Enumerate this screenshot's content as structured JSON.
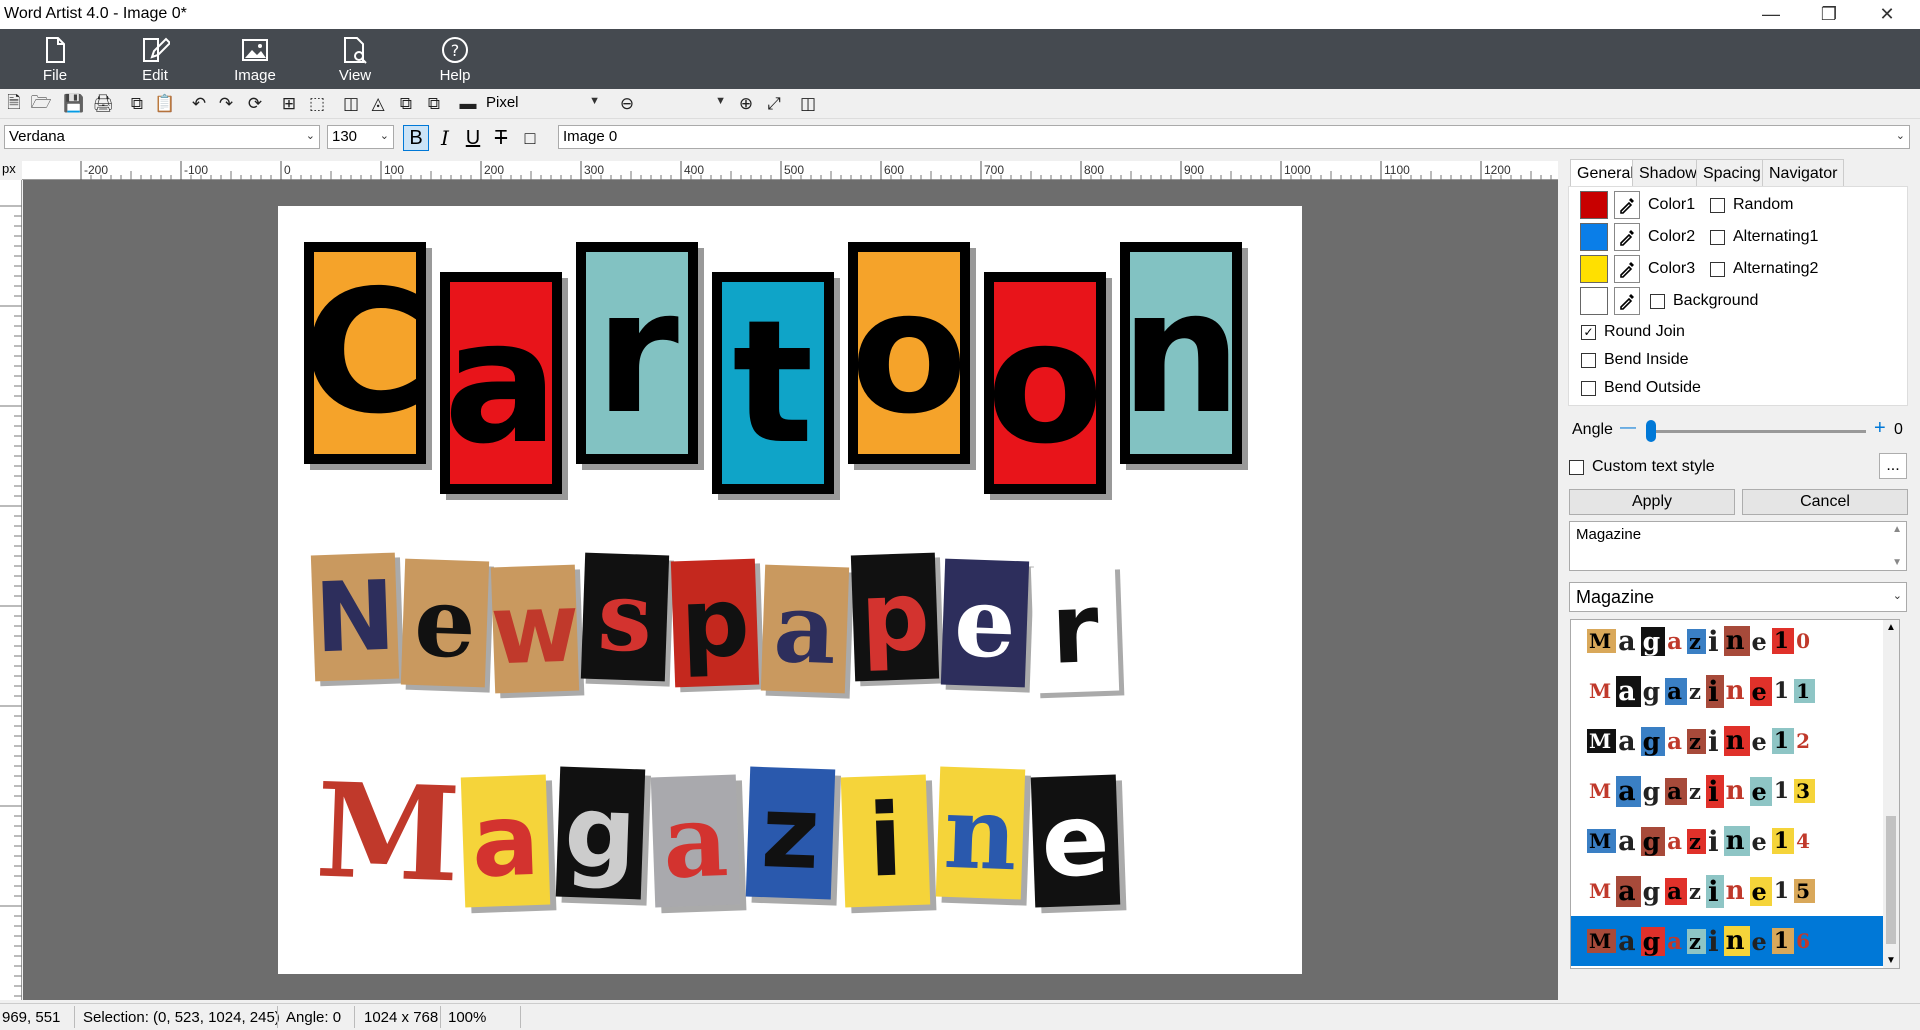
{
  "window": {
    "title": "Word Artist 4.0 - Image 0*"
  },
  "ribbon": [
    {
      "label": "File",
      "icon": "file-icon"
    },
    {
      "label": "Edit",
      "icon": "edit-icon"
    },
    {
      "label": "Image",
      "icon": "image-icon"
    },
    {
      "label": "View",
      "icon": "view-icon"
    },
    {
      "label": "Help",
      "icon": "help-icon"
    }
  ],
  "toolbar": {
    "unit": "Pixel",
    "zoom": ""
  },
  "format": {
    "font": "Verdana",
    "size": "130",
    "bold": "B",
    "italic": "I",
    "underline": "U",
    "strike": "T",
    "layer": "Image 0"
  },
  "ruler": {
    "unit": "px",
    "ticks": [
      "-200",
      "-100",
      "0",
      "100",
      "200",
      "300",
      "400",
      "500",
      "600",
      "700",
      "800",
      "900",
      "1000",
      "1100",
      "1200"
    ]
  },
  "canvas": {
    "line1": "Cartoon",
    "line2": "Newspaper",
    "line3": "Magazine"
  },
  "panel": {
    "tabs": [
      "General",
      "Shadow",
      "Spacing",
      "Navigator"
    ],
    "colors": [
      {
        "label": "Color1",
        "value": "#c80000",
        "option": "Random"
      },
      {
        "label": "Color2",
        "value": "#0a7ee8",
        "option": "Alternating1"
      },
      {
        "label": "Color3",
        "value": "#ffe000",
        "option": "Alternating2"
      },
      {
        "label": "",
        "value": "#ffffff",
        "option": "Background"
      }
    ],
    "round_join": "Round Join",
    "bend_inside": "Bend Inside",
    "bend_outside": "Bend Outside",
    "angle_label": "Angle",
    "angle_value": "0",
    "angle_fraction": 0.0,
    "custom_style": "Custom text style",
    "more": "...",
    "apply": "Apply",
    "cancel": "Cancel",
    "style_text": "Magazine",
    "style_group": "Magazine",
    "style_items": [
      "Magazine10",
      "Magazine11",
      "Magazine12",
      "Magazine13",
      "Magazine14",
      "Magazine15",
      "Magazine16"
    ]
  },
  "status": {
    "coords": "969, 551",
    "selection": "Selection: (0, 523, 1024, 245)",
    "angle": "Angle: 0",
    "size": "1024 x 768",
    "zoom": "100%"
  }
}
